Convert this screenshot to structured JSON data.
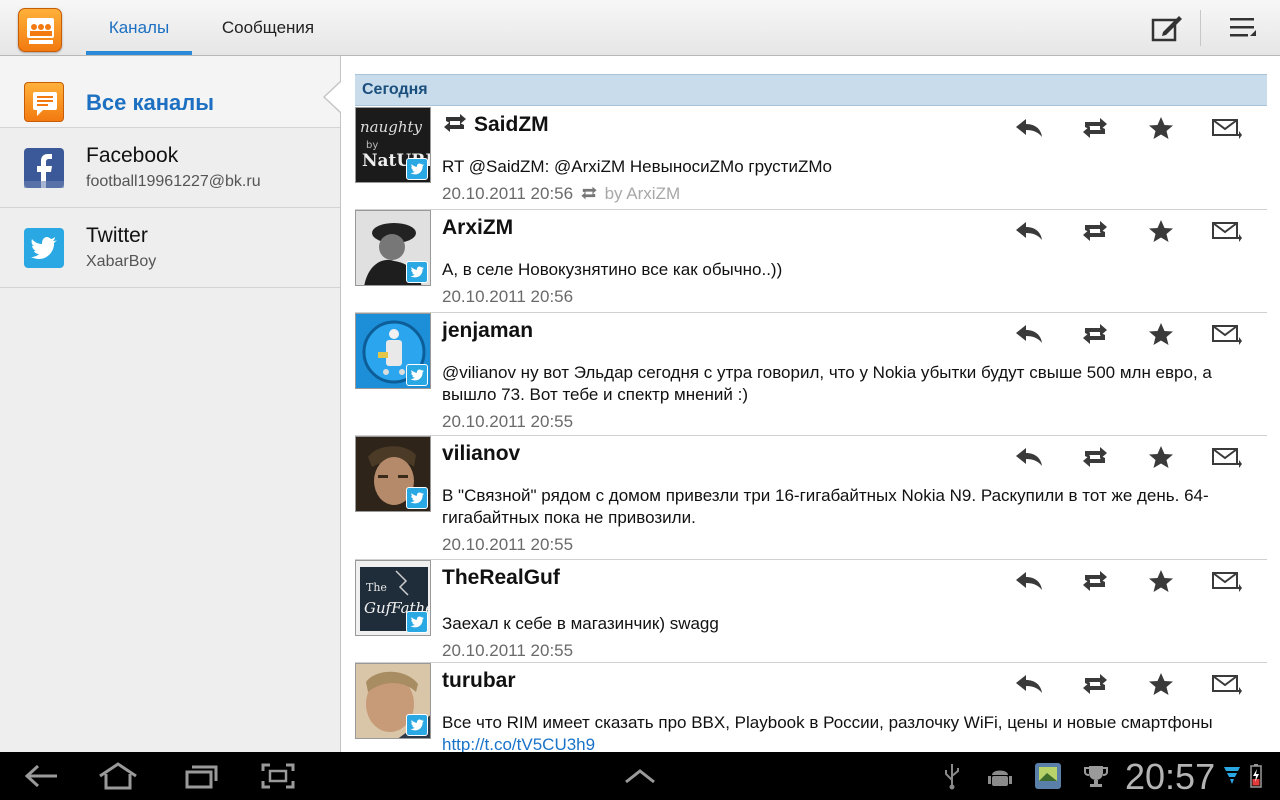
{
  "tabs": [
    {
      "label": "Каналы",
      "active": true
    },
    {
      "label": "Сообщения",
      "active": false
    }
  ],
  "sidebar": {
    "items": [
      {
        "title": "Все каналы",
        "sub": "",
        "icon": "all-channels-icon"
      },
      {
        "title": "Facebook",
        "sub": "football19961227@bk.ru",
        "icon": "facebook-icon"
      },
      {
        "title": "Twitter",
        "sub": "XabarBoy",
        "icon": "twitter-icon"
      }
    ]
  },
  "feed": {
    "section": "Сегодня",
    "posts": [
      {
        "name": "SaidZM",
        "retweet": true,
        "text": "RT @SaidZM: @ArxiZM НевыносиZMо грустиZMо",
        "time": "20.10.2011 20:56",
        "via": "by ArxiZM"
      },
      {
        "name": "ArxiZM",
        "text": "А, в селе Новокузнятино все как обычно..))",
        "time": "20.10.2011 20:56"
      },
      {
        "name": "jenjaman",
        "text": "@vilianov ну вот Эльдар сегодня с утра говорил, что у Nokia убытки будут свыше 500 млн евро, а вышло 73. Вот тебе и спектр мнений :)",
        "time": "20.10.2011 20:55"
      },
      {
        "name": "vilianov",
        "text": "В \"Связной\" рядом с домом привезли три 16-гигабайтных Nokia N9. Раскупили в тот же день. 64-гигабайтных пока не привозили.",
        "time": "20.10.2011 20:55"
      },
      {
        "name": "TheRealGuf",
        "text": "Заехал к себе в магазинчик) swagg",
        "time": "20.10.2011 20:55"
      },
      {
        "name": "turubar",
        "text": "Все что RIM имеет сказать про BBX, Playbook в России, разлочку WiFi, цены и новые смартфоны ",
        "link": "http://t.co/tV5CU3h9"
      }
    ]
  },
  "status": {
    "clock": "20:57"
  },
  "colors": {
    "accent": "#1c6fc1",
    "section": "#c9dceb",
    "twitter": "#2aa8e4",
    "facebook": "#3b5998"
  }
}
